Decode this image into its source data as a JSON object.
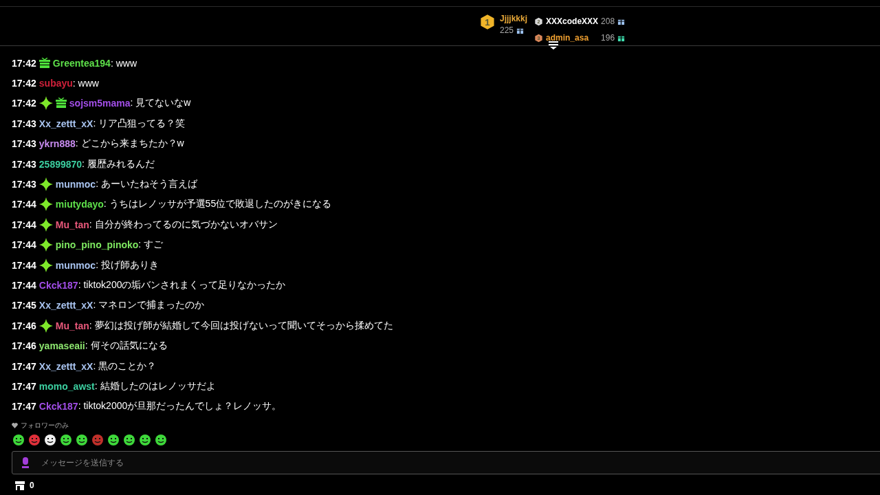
{
  "leaderboard": [
    {
      "rank": "1",
      "name": "Jjjjkkkj",
      "score": "225",
      "color": "#e8a838",
      "gift": {
        "color": "#9ec3f0"
      }
    },
    {
      "rank": "2",
      "name": "XXXcodeXXX",
      "score": "208",
      "color": "#ffffff",
      "gift": {
        "color": "#9ec3f0"
      }
    },
    {
      "rank": "3",
      "name": "admin_asa",
      "score": "196",
      "color": "#f0a030",
      "gift": {
        "color": "#3fe0b0"
      }
    }
  ],
  "messages": [
    {
      "time": "17:42",
      "badges": [
        {
          "kind": "gift"
        }
      ],
      "user": "Greentea194",
      "color": "#5ee04a",
      "text": ": www"
    },
    {
      "time": "17:42",
      "user": "subayu",
      "color": "#d0203a",
      "text": ": www"
    },
    {
      "time": "17:42",
      "badges": [
        {
          "kind": "sparkle"
        },
        {
          "kind": "gift"
        }
      ],
      "user": "sojsm5mama",
      "color": "#a24ee8",
      "text": ": 見てないなw"
    },
    {
      "time": "17:43",
      "user": "Xx_zettt_xX",
      "color": "#a9c4f0",
      "text": ": リア凸狙ってる？笑"
    },
    {
      "time": "17:43",
      "user": "ykrn888",
      "color": "#c88cf0",
      "text": ": どこから来まちたか？w"
    },
    {
      "time": "17:43",
      "user": "25899870",
      "color": "#3ccfa0",
      "text": ": 履歴みれるんだ"
    },
    {
      "time": "17:43",
      "badges": [
        {
          "kind": "sparkle"
        }
      ],
      "user": "munmoc",
      "color": "#a9c4f0",
      "text": ": あーいたねそう言えば"
    },
    {
      "time": "17:44",
      "badges": [
        {
          "kind": "sparkle"
        }
      ],
      "user": "miutydayo",
      "color": "#5ee04a",
      "text": ": うちはレノッサが予選55位で敗退したのがきになる"
    },
    {
      "time": "17:44",
      "badges": [
        {
          "kind": "sparkle"
        }
      ],
      "user": "Mu_tan",
      "color": "#e8587a",
      "text": ": 自分が終わってるのに気づかないオバサン"
    },
    {
      "time": "17:44",
      "badges": [
        {
          "kind": "sparkle"
        }
      ],
      "user": "pino_pino_pinoko",
      "color": "#7ee860",
      "text": ": すご"
    },
    {
      "time": "17:44",
      "badges": [
        {
          "kind": "sparkle"
        }
      ],
      "user": "munmoc",
      "color": "#a9c4f0",
      "text": ": 投げ師ありき"
    },
    {
      "time": "17:44",
      "user": "Ckck187",
      "color": "#a24ee8",
      "text": ": tiktok200の垢バンされまくって足りなかったか"
    },
    {
      "time": "17:45",
      "user": "Xx_zettt_xX",
      "color": "#a9c4f0",
      "text": ": マネロンで捕まったのか"
    },
    {
      "time": "17:46",
      "badges": [
        {
          "kind": "sparkle"
        }
      ],
      "user": "Mu_tan",
      "color": "#e8587a",
      "text": ": 夢幻は投げ師が結婚して今回は投げないって聞いてそっから揉めてた"
    },
    {
      "time": "17:46",
      "user": "yamaseaii",
      "color": "#8ee870",
      "text": ": 何その話気になる"
    },
    {
      "time": "17:47",
      "user": "Xx_zettt_xX",
      "color": "#a9c4f0",
      "text": ": 黒のことか？"
    },
    {
      "time": "17:47",
      "user": "momo_awst",
      "color": "#3ccfa0",
      "text": ": 結婚したのはレノッサだよ"
    },
    {
      "time": "17:47",
      "user": "Ckck187",
      "color": "#a24ee8",
      "text": ": tiktok2000が旦那だったんでしょ？レノッサ。"
    }
  ],
  "chat_mode": "フォロワーのみ",
  "input": {
    "placeholder": "メッセージを送信する"
  },
  "store_count": "0"
}
